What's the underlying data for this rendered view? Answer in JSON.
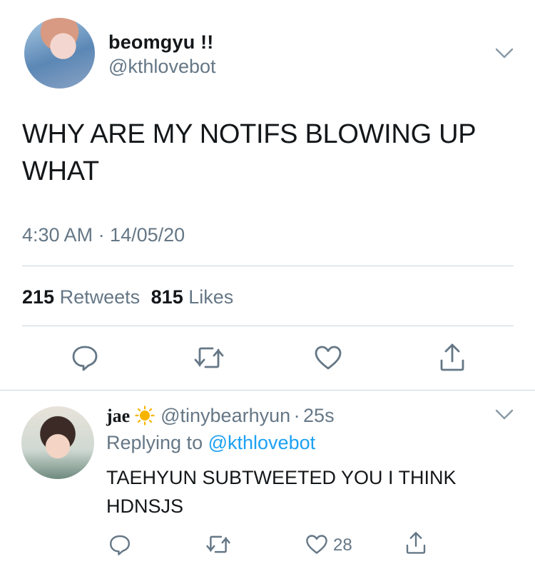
{
  "tweet": {
    "author_name": "beomgyu !!",
    "author_handle": "@kthlovebot",
    "text": "WHY ARE MY NOTIFS BLOWING UP WHAT",
    "time": "4:30 AM · 14/05/20",
    "retweets_count": "215",
    "retweets_label": "Retweets",
    "likes_count": "815",
    "likes_label": "Likes"
  },
  "reply": {
    "author_name": "jae",
    "author_emoji": "sun-icon",
    "author_handle": "@tinybearhyun",
    "separator": "·",
    "age": "25s",
    "replying_prefix": "Replying to",
    "replying_handle": "@kthlovebot",
    "text": "TAEHYUN SUBTWEETED YOU I THINK HDNSJS",
    "like_count": "28"
  },
  "icons": {
    "reply": "reply-icon",
    "retweet": "retweet-icon",
    "like": "heart-icon",
    "share": "share-icon",
    "more": "chevron-down-icon"
  },
  "colors": {
    "text": "#14171a",
    "secondary": "#657786",
    "link": "#1da1f2",
    "divider": "#ccd6dd",
    "sun": "#f7b500"
  }
}
